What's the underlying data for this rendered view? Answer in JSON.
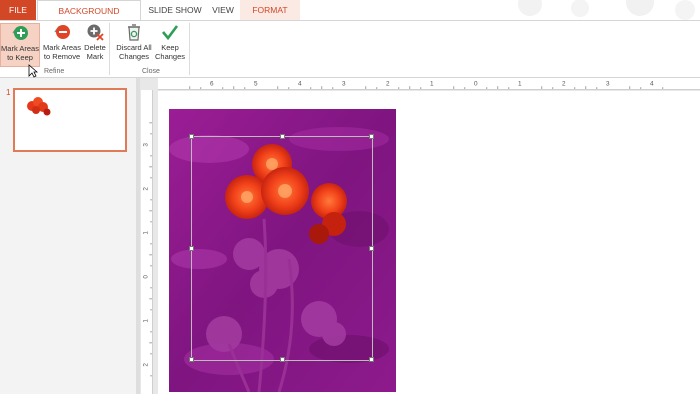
{
  "tabs": {
    "file": "FILE",
    "background_removal": "BACKGROUND REMOVAL",
    "slide_show": "SLIDE SHOW",
    "view": "VIEW",
    "format": "FORMAT"
  },
  "ribbon": {
    "refine": {
      "label": "Refine",
      "mark_keep": [
        "Mark Areas",
        "to Keep"
      ],
      "mark_remove": [
        "Mark Areas",
        "to Remove"
      ],
      "delete_mark": [
        "Delete",
        "Mark"
      ]
    },
    "close": {
      "label": "Close",
      "discard": [
        "Discard All",
        "Changes"
      ],
      "keep": [
        "Keep",
        "Changes"
      ]
    }
  },
  "thumbnail_pane": {
    "slide_number": "1"
  },
  "rulers": {
    "horizontal_labels": [
      "6",
      "5",
      "4",
      "3",
      "2",
      "1",
      "0",
      "1",
      "2",
      "3",
      "4"
    ],
    "vertical_labels": [
      "3",
      "2",
      "1",
      "0",
      "1",
      "2"
    ]
  },
  "colors": {
    "accent": "#d24726",
    "removed_overlay": "#8e1a8a",
    "kept_flowers": "#ff4a1c"
  }
}
